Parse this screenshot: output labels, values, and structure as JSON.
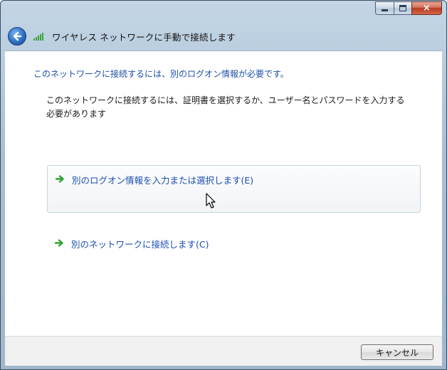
{
  "window": {
    "title": "ワイヤレス ネットワークに手動で接続します",
    "controls": {
      "close_glyph": "×"
    }
  },
  "icons": {
    "back": "back-arrow-icon",
    "signal": "wireless-signal-icon",
    "command_arrow": "green-arrow-icon"
  },
  "colors": {
    "instruction_text": "#1f4fa6",
    "link_text": "#1d50b0",
    "arrow": "#2fa52f"
  },
  "content": {
    "instruction": "このネットワークに接続するには、別のログオン情報が必要です。",
    "description": "このネットワークに接続するには、証明書を選択するか、ユーザー名とパスワードを入力する必要があります",
    "options": [
      {
        "label": "別のログオン情報を入力または選択します(E)"
      },
      {
        "label": "別のネットワークに接続します(C)"
      }
    ]
  },
  "footer": {
    "cancel_label": "キャンセル"
  }
}
